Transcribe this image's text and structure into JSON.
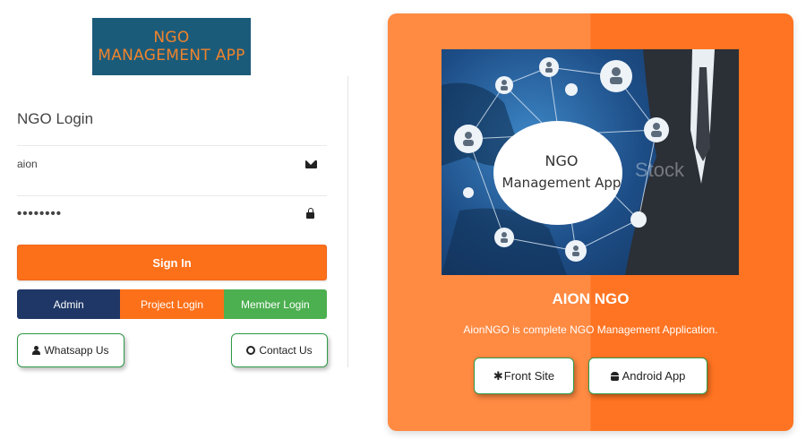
{
  "logo": {
    "line1": "NGO",
    "line2": "MANAGEMENT APP"
  },
  "login": {
    "title": "NGO Login",
    "username_value": "aion",
    "password_value": "••••••••",
    "signin_label": "Sign In"
  },
  "roles": {
    "admin": "Admin",
    "project": "Project Login",
    "member": "Member Login"
  },
  "links": {
    "whatsapp": "Whatsapp Us",
    "contact": "Contact Us"
  },
  "card": {
    "hero_text_line1": "NGO",
    "hero_text_line2": "Management App",
    "hero_watermark": "Stock",
    "title": "AION NGO",
    "description": "AionNGO is complete NGO Management Application.",
    "front_site_label": "Front Site",
    "android_label": "Android App"
  },
  "colors": {
    "orange": "#fc7019",
    "navy": "#1f3766",
    "green": "#4caf50",
    "logo_bg": "#1b5b7a"
  },
  "icons": [
    "envelope-icon",
    "lock-icon",
    "user-icon",
    "support-icon",
    "asterisk-icon",
    "android-icon"
  ]
}
